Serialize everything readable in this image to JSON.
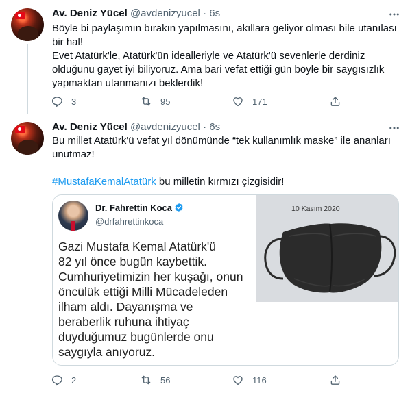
{
  "tweets": [
    {
      "name": "Av. Deniz Yücel",
      "handle": "@avdenizyucel",
      "separator": "·",
      "time": "6s",
      "text": "Böyle bi paylaşımın bırakın yapılmasını, akıllara geliyor olması bile utanılası bir hal!\nEvet Atatürk'le, Atatürk'ün idealleriyle ve Atatürk'ü sevenlerle derdiniz olduğunu gayet iyi biliyoruz. Ama bari vefat ettiği gün böyle bir saygısızlık yapmaktan utanmanızı beklerdik!",
      "replies": "3",
      "retweets": "95",
      "likes": "171"
    },
    {
      "name": "Av. Deniz Yücel",
      "handle": "@avdenizyucel",
      "separator": "·",
      "time": "6s",
      "text": "Bu millet Atatürk'ü vefat yıl dönümünde “tek kullanımlık maske” ile ananları unutmaz!",
      "hashtag": "#MustafaKemalAtatürk",
      "text_after": " bu milletin kırmızı çizgisidir!",
      "replies": "2",
      "retweets": "56",
      "likes": "116"
    }
  ],
  "embedded_image": {
    "author_name": "Dr. Fahrettin Koca",
    "author_handle": "@drfahrettinkoca",
    "body": "Gazi Mustafa Kemal Atatürk'ü\n82 yıl önce bugün kaybettik.\nCumhuriyetimizin her kuşağı, onun\nöncülük ettiği Milli Mücadeleden\nilham aldı. Dayanışma ve\nberaberlik ruhuna ihtiyaç\nduyduğumuz bugünlerde onu\nsaygıyla anıyoruz.",
    "date_label": "10 Kasım 2020"
  },
  "icons": {
    "more": "more-icon",
    "reply": "reply-icon",
    "retweet": "retweet-icon",
    "like": "like-icon",
    "share": "share-icon",
    "verified": "verified-icon"
  },
  "colors": {
    "link": "#1d9bf0",
    "secondary_text": "#536471",
    "verified": "#1d9bf0"
  }
}
